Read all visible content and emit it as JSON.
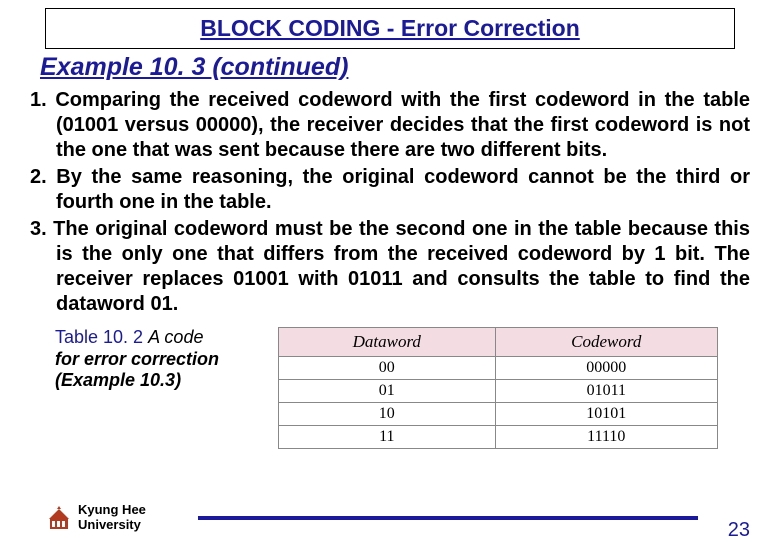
{
  "title": "BLOCK CODING - Error Correction",
  "subtitle": "Example 10. 3 (continued)",
  "items": [
    "1. Comparing the received codeword with the first codeword in the table (01001 versus 00000), the receiver decides that the first codeword is not the one that was sent because there are two different bits.",
    "2. By the same reasoning, the original codeword cannot be the third or fourth one in the table.",
    "3. The original codeword must be the second one in the table because this is the only one that differs from the received codeword by 1 bit. The receiver replaces 01001 with 01011 and consults the table to find the dataword  01."
  ],
  "table_caption": {
    "num": "Table 10. 2",
    "desc": "A code",
    "sub": "for error correction (Example 10.3)"
  },
  "table": {
    "headers": [
      "Dataword",
      "Codeword"
    ],
    "rows": [
      [
        "00",
        "00000"
      ],
      [
        "01",
        "01011"
      ],
      [
        "10",
        "10101"
      ],
      [
        "11",
        "11110"
      ]
    ]
  },
  "university": {
    "line1": "Kyung Hee",
    "line2": "University"
  },
  "page_number": "23",
  "chart_data": {
    "type": "table",
    "title": "Table 10.2 A code for error correction (Example 10.3)",
    "columns": [
      "Dataword",
      "Codeword"
    ],
    "rows": [
      {
        "Dataword": "00",
        "Codeword": "00000"
      },
      {
        "Dataword": "01",
        "Codeword": "01011"
      },
      {
        "Dataword": "10",
        "Codeword": "10101"
      },
      {
        "Dataword": "11",
        "Codeword": "11110"
      }
    ]
  }
}
